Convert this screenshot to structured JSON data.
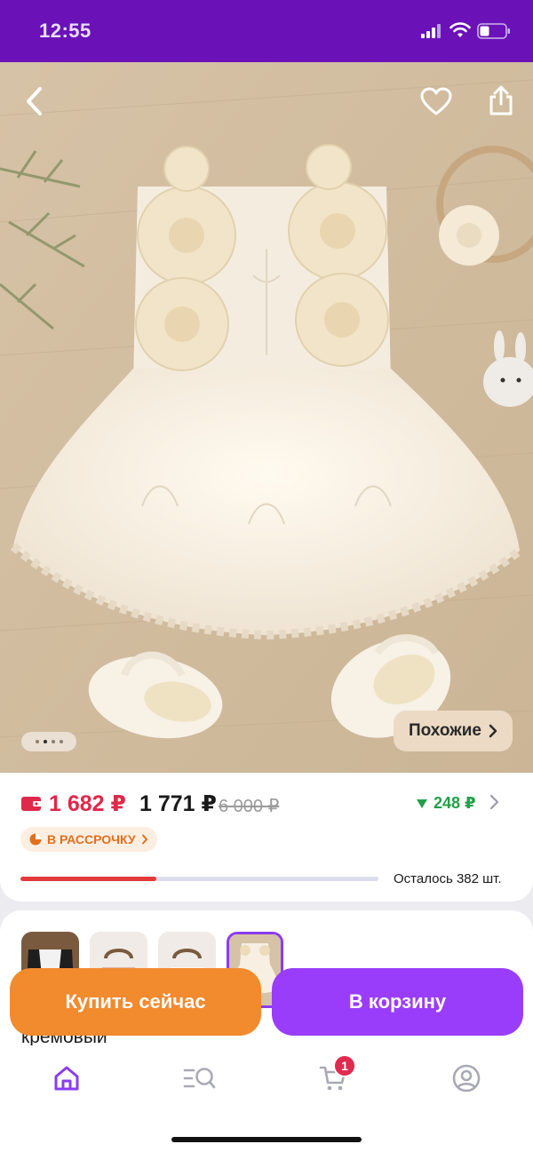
{
  "status_bar": {
    "time": "12:55"
  },
  "hero": {
    "back_icon": "chevron-left-icon",
    "favorite_icon": "heart-icon",
    "share_icon": "share-icon",
    "gallery": {
      "count": 4,
      "active_index": 1
    },
    "similar_label": "Похожие"
  },
  "price": {
    "card_price": "1 682 ₽",
    "price": "1 771 ₽",
    "old_price": "6 000 ₽",
    "cashback": "248 ₽",
    "installment_label": "В РАССРОЧКУ",
    "stock_progress": 0.38,
    "stock_text": "Осталось 382 шт."
  },
  "variants": {
    "selected_index": 3,
    "selected_label": "кремовый"
  },
  "actions": {
    "buy_now": "Купить сейчас",
    "add_to_cart": "В корзину"
  },
  "bottom_nav": {
    "items": [
      "home-icon",
      "catalog-search-icon",
      "cart-icon",
      "profile-icon"
    ],
    "cart_badge": "1"
  },
  "colors": {
    "brand_purple": "#6a12b8",
    "price_red": "#e0284a",
    "cashback_green": "#22a04a",
    "buy_orange": "#f28a2e",
    "cart_purple": "#9a3dfa"
  }
}
